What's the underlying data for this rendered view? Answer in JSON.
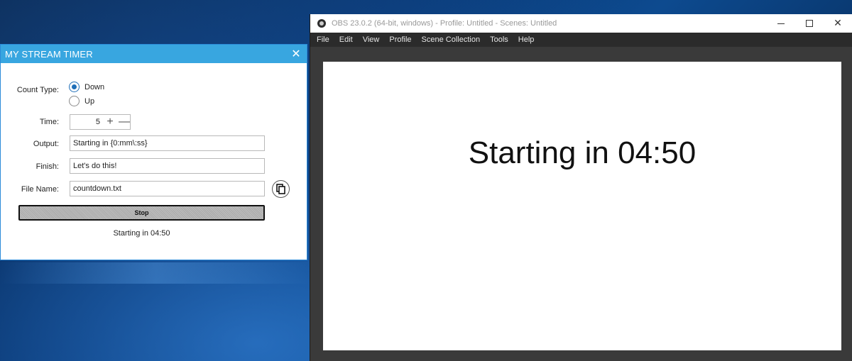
{
  "timer_window": {
    "title": "MY STREAM TIMER",
    "close_glyph": "✕",
    "count_type": {
      "label": "Count Type:",
      "options": [
        {
          "label": "Down",
          "checked": true
        },
        {
          "label": "Up",
          "checked": false
        }
      ]
    },
    "time": {
      "label": "Time:",
      "value": "5",
      "plus": "+",
      "minus": "—"
    },
    "output": {
      "label": "Output:",
      "value": "Starting in {0:mm\\:ss}"
    },
    "finish": {
      "label": "Finish:",
      "value": "Let's do this!"
    },
    "file_name": {
      "label": "File Name:",
      "value": "countdown.txt",
      "copy_icon": "copy-icon"
    },
    "stop_label": "Stop",
    "status": "Starting in 04:50"
  },
  "obs_window": {
    "title": "OBS 23.0.2 (64-bit, windows) - Profile: Untitled - Scenes: Untitled",
    "menu": [
      "File",
      "Edit",
      "View",
      "Profile",
      "Scene Collection",
      "Tools",
      "Help"
    ],
    "close_glyph": "✕",
    "preview_text": "Starting in 04:50"
  }
}
